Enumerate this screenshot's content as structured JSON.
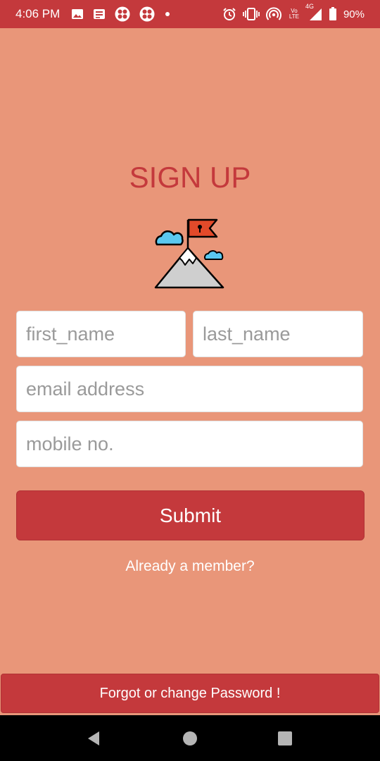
{
  "status_bar": {
    "time": "4:06 PM",
    "network": "4G",
    "volte": "Vo LTE",
    "battery_percent": "90%",
    "left_icons": [
      "image-icon",
      "message-icon",
      "app-grid-icon",
      "app-grid-icon",
      "dot-icon"
    ],
    "right_icons": [
      "alarm-icon",
      "vibrate-icon",
      "hotspot-icon",
      "volte-icon",
      "signal-icon",
      "battery-icon"
    ]
  },
  "title": "SIGN UP",
  "form": {
    "first_name_placeholder": "first_name",
    "last_name_placeholder": "last_name",
    "email_placeholder": "email address",
    "mobile_placeholder": "mobile no.",
    "submit_label": "Submit"
  },
  "already_member": "Already a member?",
  "forgot_password": "Forgot or change Password !",
  "nav": [
    "back-icon",
    "home-icon",
    "recents-icon"
  ],
  "colors": {
    "background": "#E99679",
    "accent": "#C4393C",
    "field": "#FFFFFF"
  }
}
